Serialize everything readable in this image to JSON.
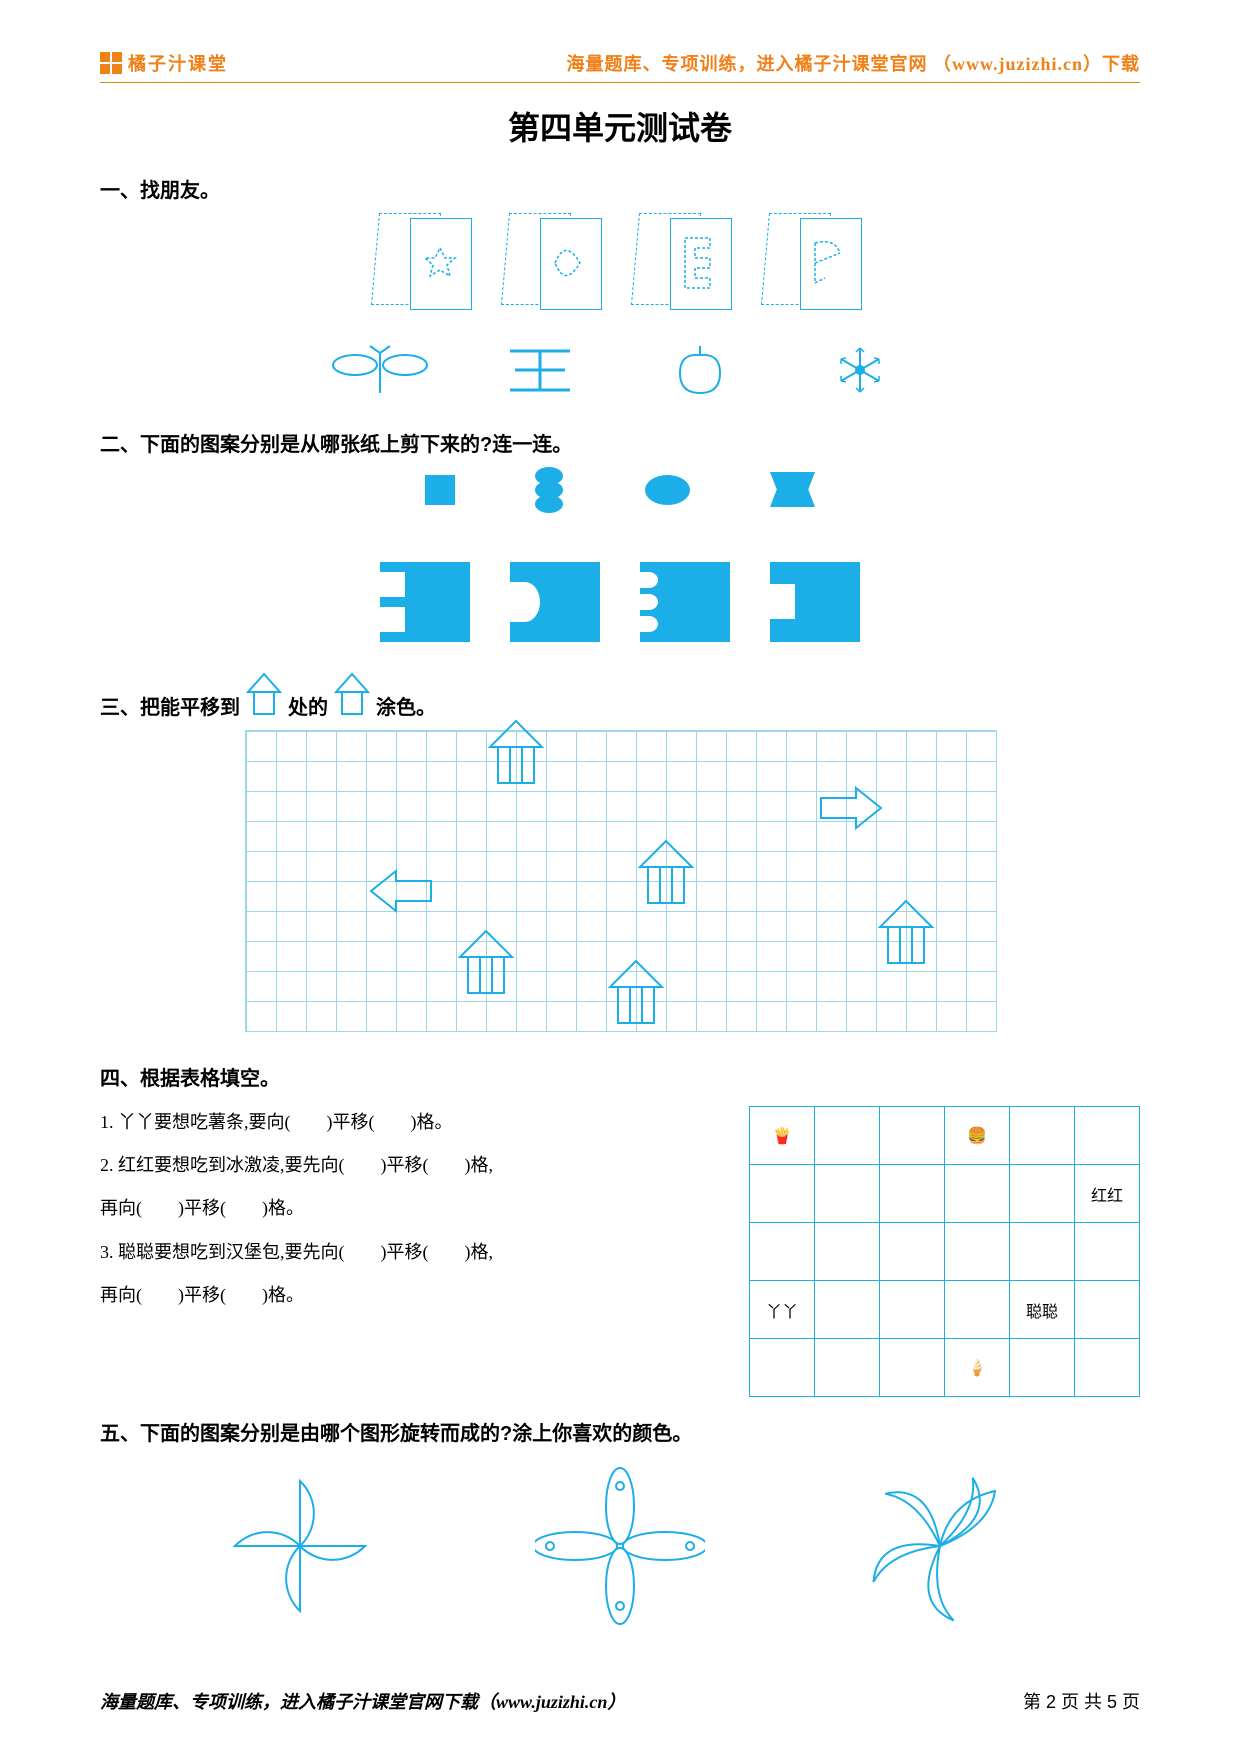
{
  "header": {
    "brand": "橘子汁课堂",
    "right": "海量题库、专项训练，进入橘子汁课堂官网 （www.juzizhi.cn）下载"
  },
  "title": "第四单元测试卷",
  "s1": {
    "head": "一、找朋友。"
  },
  "s2": {
    "head": "二、下面的图案分别是从哪张纸上剪下来的?连一连。"
  },
  "s3": {
    "pre": "三、把能平移到",
    "mid": "处的",
    "post": "涂色。"
  },
  "s4": {
    "head": "四、根据表格填空。",
    "q1": "1. 丫丫要想吃薯条,要向(　　)平移(　　)格。",
    "q2": "2. 红红要想吃到冰激凌,要先向(　　)平移(　　)格,",
    "q2b": "再向(　　)平移(　　)格。",
    "q3": "3. 聪聪要想吃到汉堡包,要先向(　　)平移(　　)格,",
    "q3b": "再向(　　)平移(　　)格。",
    "table": {
      "fries": "🍟",
      "burger": "🍔",
      "icecream": "🍦",
      "honghong": "红红",
      "yaya": "丫丫",
      "congcong": "聪聪"
    }
  },
  "s5": {
    "head": "五、下面的图案分别是由哪个图形旋转而成的?涂上你喜欢的颜色。"
  },
  "footer": {
    "left": "海量题库、专项训练，进入橘子汁课堂官网下载（www.juzizhi.cn）",
    "right": "第 2 页 共 5 页"
  },
  "colors": {
    "accent": "#1caee6",
    "brand": "#f08018"
  }
}
